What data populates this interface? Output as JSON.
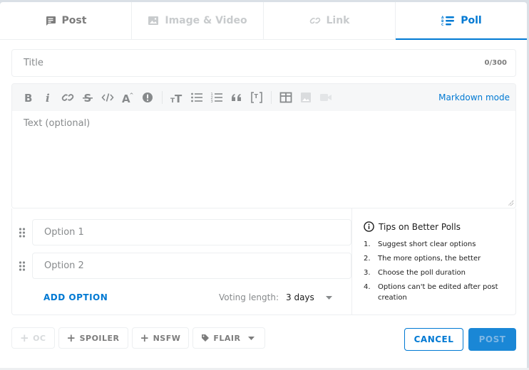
{
  "tabs": [
    {
      "label": "Post",
      "icon": "post-icon",
      "state": "normal"
    },
    {
      "label": "Image & Video",
      "icon": "image-icon",
      "state": "disabled"
    },
    {
      "label": "Link",
      "icon": "link-icon",
      "state": "disabled"
    },
    {
      "label": "Poll",
      "icon": "poll-icon",
      "state": "active"
    }
  ],
  "title": {
    "placeholder": "Title",
    "value": "",
    "counter": "0/300"
  },
  "editor": {
    "toolbar": [
      "bold",
      "italic",
      "link",
      "strikethrough",
      "inline-code",
      "superscript",
      "spoiler",
      "heading",
      "bulleted-list",
      "numbered-list",
      "quote-block",
      "code-block",
      "table",
      "image",
      "video"
    ],
    "markdown_mode": "Markdown mode",
    "placeholder": "Text (optional)"
  },
  "poll": {
    "options": [
      {
        "placeholder": "Option 1",
        "value": ""
      },
      {
        "placeholder": "Option 2",
        "value": ""
      }
    ],
    "add_option": "ADD OPTION",
    "voting_length_label": "Voting length:",
    "voting_length_value": "3 days"
  },
  "tips": {
    "title": "Tips on Better Polls",
    "items": [
      {
        "n": "1.",
        "text": "Suggest short clear options"
      },
      {
        "n": "2.",
        "text": "The more options, the better"
      },
      {
        "n": "3.",
        "text": "Choose the poll duration"
      },
      {
        "n": "4.",
        "text": "Options can't be edited after post creation"
      }
    ]
  },
  "tags": {
    "oc": "OC",
    "spoiler": "SPOILER",
    "nsfw": "NSFW",
    "flair": "FLAIR"
  },
  "actions": {
    "cancel": "CANCEL",
    "post": "POST"
  },
  "colors": {
    "accent": "#0079d3",
    "background": "#dae0e6",
    "text": "#1c1c1c",
    "muted": "#878a8c"
  }
}
